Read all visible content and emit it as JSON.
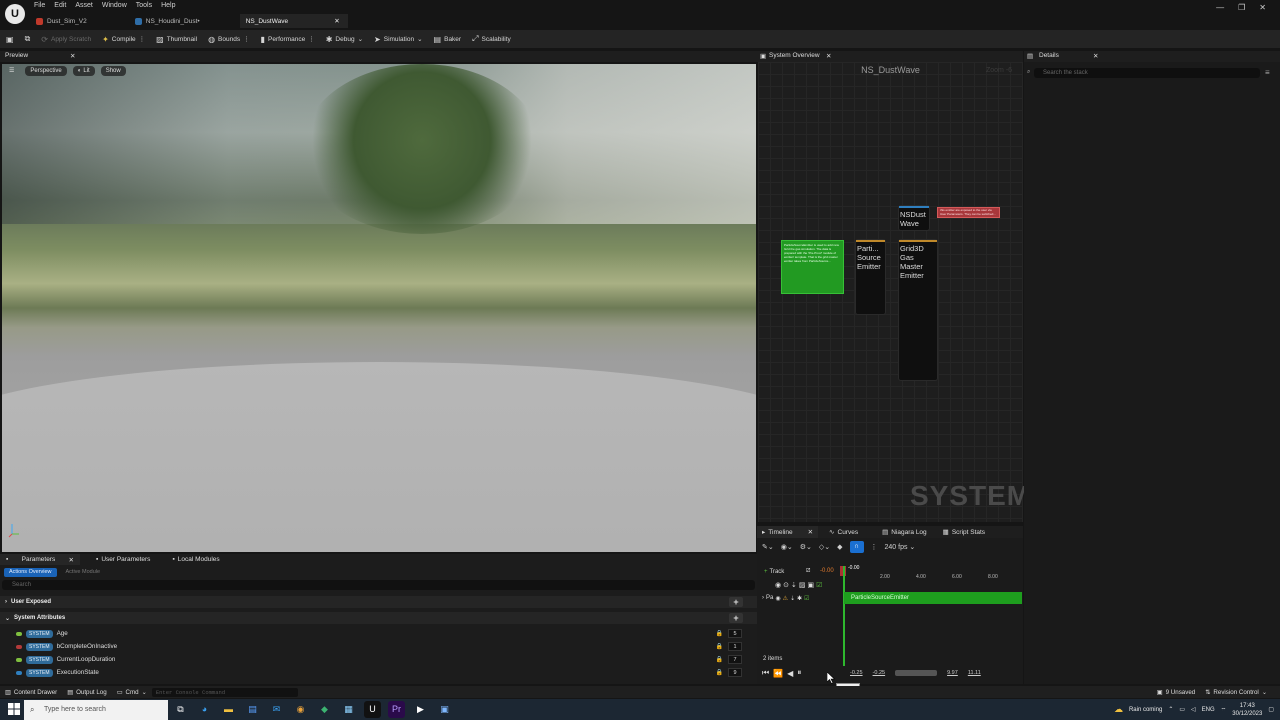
{
  "menu": [
    "File",
    "Edit",
    "Asset",
    "Window",
    "Tools",
    "Help"
  ],
  "logo": "U",
  "doc_tabs": [
    {
      "label": "Dust_Sim_V2"
    },
    {
      "label": "NS_Houdini_Dust•"
    },
    {
      "label": "NS_DustWave",
      "close": "✕"
    }
  ],
  "window_controls": {
    "minimize": "—",
    "maximize": "❐",
    "close": "✕"
  },
  "toolbar": {
    "apply_scratch": "Apply Scratch",
    "compile": "Compile",
    "thumbnail": "Thumbnail",
    "bounds": "Bounds",
    "performance": "Performance",
    "debug": "Debug",
    "simulation": "Simulation",
    "baker": "Baker",
    "scalability": "Scalability"
  },
  "preview": {
    "title": "Preview",
    "close": "✕",
    "perspective": "Perspective",
    "lit": "Lit",
    "show": "Show"
  },
  "parameters": {
    "tabs": [
      "Parameters",
      "User Parameters",
      "Local Modules"
    ],
    "sub_tabs": [
      "Actions Overview",
      "Active Module"
    ],
    "search_placeholder": "Search",
    "sections": {
      "user_exposed": "User Exposed",
      "system_attributes": "System Attributes"
    },
    "rows": [
      {
        "badge": "SYSTEM",
        "name": "Age",
        "value": "5",
        "dot": "#7fbf3f"
      },
      {
        "badge": "SYSTEM",
        "name": "bCompleteOnInactive",
        "value": "1",
        "dot": "#b33a3a"
      },
      {
        "badge": "SYSTEM",
        "name": "CurrentLoopDuration",
        "value": "7",
        "dot": "#7fbf3f"
      },
      {
        "badge": "SYSTEM",
        "name": "ExecutionState",
        "value": "9",
        "dot": "#2f7fbf"
      }
    ]
  },
  "system_overview": {
    "tab": "System Overview",
    "close": "✕",
    "title": "NS_DustWave",
    "zoom": "Zoom -6",
    "watermark": "SYSTEM",
    "nodes": [
      {
        "label": "NSDust\nWave",
        "bar": "#2f7fbf"
      },
      {
        "label": "Parti...\nSource\nEmitter",
        "bar": "#c0892a"
      },
      {
        "label": "Grid3D\nGas\nMaster\nEmitter",
        "bar": "#c0892a"
      }
    ],
    "note_green": "ParticleSourceEmitter is used to add new Grid the gas simulation. The data is prepared with the 'Pre-Proof' module of emitter/ template. That is the grid master emitter takes from ParticleSource...",
    "note_red": "this emitter are exposed to the user via User Parameters. They can be switched..."
  },
  "details": {
    "tab": "Details",
    "close": "✕",
    "search_placeholder": "Search the stack"
  },
  "timeline": {
    "tabs": [
      "Timeline",
      "Curves",
      "Niagara Log",
      "Script Stats"
    ],
    "fps": "240 fps",
    "track_button": "Track",
    "start": "-0.00",
    "playhead": "-0.00",
    "ticks": [
      "2.00",
      "4.00",
      "6.00",
      "8.00"
    ],
    "track_name": "Pa",
    "emitter_label": "ParticleSourceEmitter",
    "items": "2 items",
    "range": [
      "-0.25",
      "-0.25",
      "9.97",
      "11.11"
    ],
    "tooltip": "Pause"
  },
  "status": {
    "content_drawer": "Content Drawer",
    "output_log": "Output Log",
    "cmd": "Cmd",
    "console_placeholder": "Enter Console Command",
    "unsaved": "9 Unsaved",
    "revision": "Revision Control"
  },
  "taskbar": {
    "search_placeholder": "Type here to search",
    "weather": "Rain coming",
    "lang": "ENG",
    "time": "17:43",
    "date": "30/12/2023"
  }
}
